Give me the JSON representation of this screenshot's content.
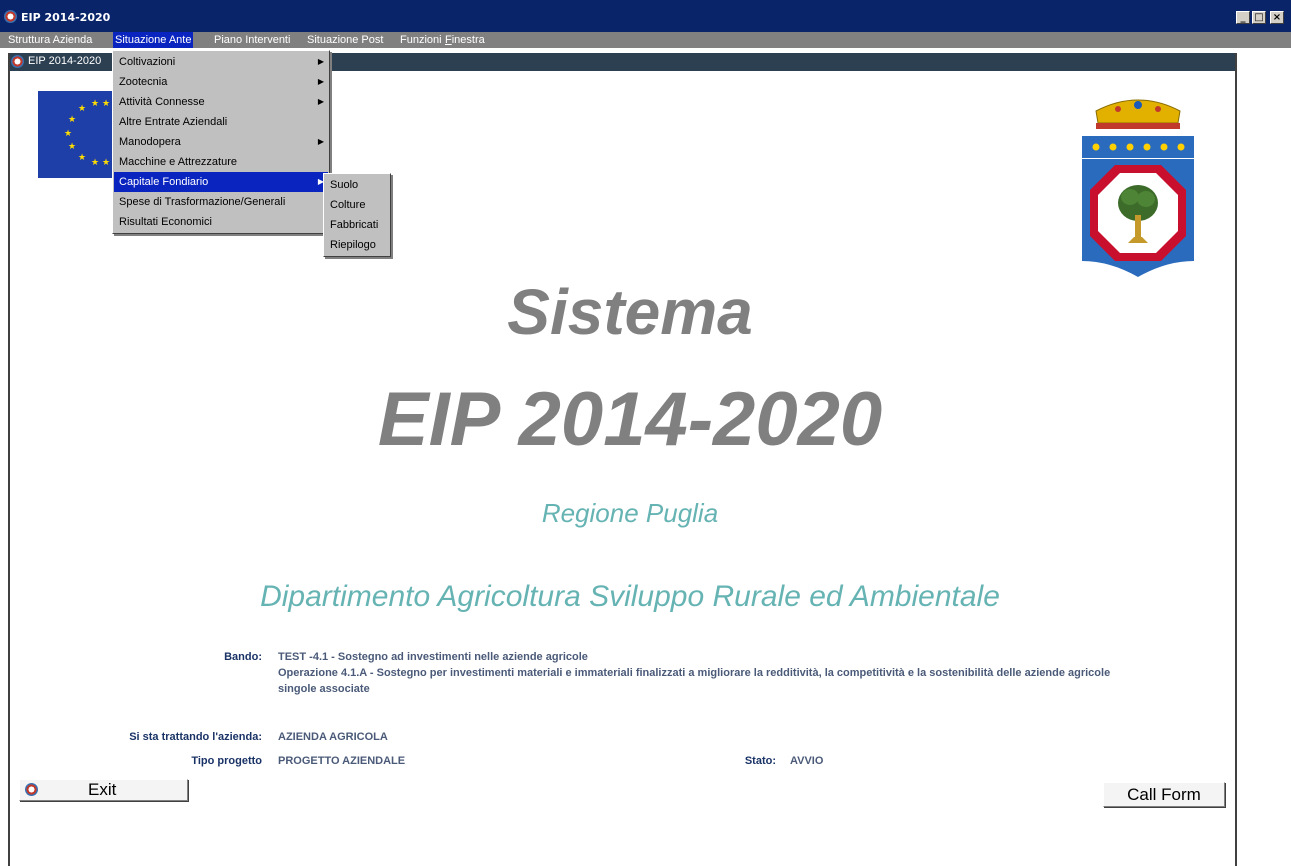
{
  "window": {
    "title": "EIP 2014-2020",
    "controls": [
      "_",
      "□",
      "×"
    ]
  },
  "menubar": {
    "items": [
      {
        "label": "Struttura Azienda"
      },
      {
        "label": "Situazione Ante",
        "active": true
      },
      {
        "label": "Piano Interventi"
      },
      {
        "label": "Situazione Post"
      },
      {
        "label": "Funzioni"
      },
      {
        "label": "Finestra",
        "mnemonic": "F"
      }
    ]
  },
  "inner_window": {
    "title": "EIP 2014-2020"
  },
  "dropdown": {
    "items": [
      {
        "label": "Coltivazioni",
        "submenu": true
      },
      {
        "label": "Zootecnia",
        "submenu": true
      },
      {
        "label": "Attività Connesse",
        "submenu": true
      },
      {
        "label": "Altre Entrate Aziendali",
        "submenu": false
      },
      {
        "label": "Manodopera",
        "submenu": true
      },
      {
        "label": "Macchine e Attrezzature",
        "submenu": false
      },
      {
        "label": "Capitale Fondiario",
        "submenu": true,
        "selected": true
      },
      {
        "label": "Spese di Trasformazione/Generali",
        "submenu": false
      },
      {
        "label": "Risultati Economici",
        "submenu": false
      }
    ]
  },
  "submenu": {
    "items": [
      {
        "label": "Suolo"
      },
      {
        "label": "Colture"
      },
      {
        "label": "Fabbricati"
      },
      {
        "label": "Riepilogo"
      }
    ]
  },
  "heading": {
    "line1": "Sistema",
    "line2": "EIP 2014-2020",
    "region": "Regione Puglia",
    "department": "Dipartimento Agricoltura Sviluppo Rurale ed Ambientale"
  },
  "info": {
    "bando_label": "Bando:",
    "bando_line1": "TEST -4.1 - Sostegno ad investimenti nelle aziende agricole",
    "bando_line2": "Operazione 4.1.A - Sostegno per investimenti materiali e immateriali finalizzati a migliorare la redditività, la competitività e la sostenibilità delle aziende agricole",
    "bando_line3": "singole associate",
    "azienda_label": "Si sta trattando l'azienda:",
    "azienda_value": "AZIENDA AGRICOLA",
    "tipo_label": "Tipo progetto",
    "tipo_value": "PROGETTO AZIENDALE",
    "stato_label": "Stato:",
    "stato_value": "AVVIO"
  },
  "buttons": {
    "exit": "Exit",
    "call_form": "Call Form"
  },
  "colors": {
    "titlebar": "#0a246a",
    "menubar": "#808080",
    "menu_highlight": "#0a24c0",
    "heading_gray": "#808080",
    "heading_teal": "#66b3b3",
    "label_blue": "#1a3366"
  }
}
